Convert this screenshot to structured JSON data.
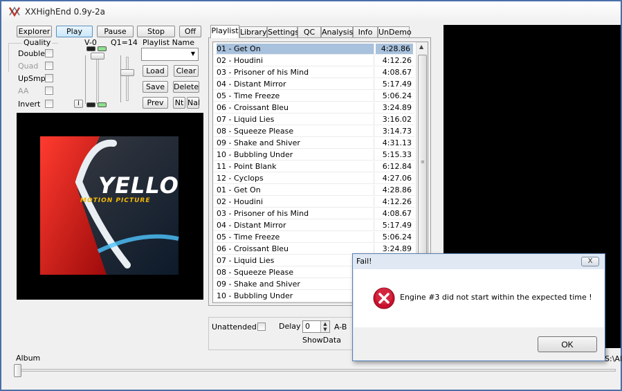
{
  "window": {
    "title": "XXHighEnd 0.9y-2a"
  },
  "transport": {
    "explorer": "Explorer",
    "play": "Play",
    "pause": "Pause",
    "stop": "Stop",
    "off": "Off"
  },
  "quality": {
    "title": "Quality",
    "options": [
      {
        "label": "Double",
        "enabled": true
      },
      {
        "label": "Quad",
        "enabled": false
      },
      {
        "label": "UpSmp",
        "enabled": true
      },
      {
        "label": "AA",
        "enabled": false
      },
      {
        "label": "Invert",
        "enabled": true
      }
    ]
  },
  "sliders": {
    "v_label": "V-0",
    "q_label": "Q1=14",
    "i_button": "I"
  },
  "playlist_controls": {
    "name_label": "Playlist Name",
    "load": "Load",
    "clear": "Clear",
    "save": "Save",
    "delete": "Delete",
    "prev": "Prev",
    "nt": "Nt",
    "nal": "Nal"
  },
  "album_art": {
    "artist": "YELLO",
    "album": "MOTION PICTURE"
  },
  "tabs": [
    "Playlist",
    "Library",
    "Settings",
    "QC",
    "Analysis",
    "Info",
    "UnDemo"
  ],
  "playlist": {
    "tracks": [
      {
        "name": "01 - Get On",
        "duration": "4:28.86",
        "selected": true
      },
      {
        "name": "02 - Houdini",
        "duration": "4:12.26"
      },
      {
        "name": "03 - Prisoner of his Mind",
        "duration": "4:08.67"
      },
      {
        "name": "04 - Distant Mirror",
        "duration": "5:17.49"
      },
      {
        "name": "05 - Time Freeze",
        "duration": "5:06.24"
      },
      {
        "name": "06 - Croissant Bleu",
        "duration": "3:24.89"
      },
      {
        "name": "07 - Liquid Lies",
        "duration": "3:16.02"
      },
      {
        "name": "08 - Squeeze Please",
        "duration": "3:14.73"
      },
      {
        "name": "09 - Shake and Shiver",
        "duration": "4:31.13"
      },
      {
        "name": "10 - Bubbling Under",
        "duration": "5:15.33"
      },
      {
        "name": "11 - Point Blank",
        "duration": "6:12.84"
      },
      {
        "name": "12 - Cyclops",
        "duration": "4:27.06"
      },
      {
        "name": "01 - Get On",
        "duration": "4:28.86"
      },
      {
        "name": "02 - Houdini",
        "duration": "4:12.26"
      },
      {
        "name": "03 - Prisoner of his Mind",
        "duration": "4:08.67"
      },
      {
        "name": "04 - Distant Mirror",
        "duration": "5:17.49"
      },
      {
        "name": "05 - Time Freeze",
        "duration": "5:06.24"
      },
      {
        "name": "06 - Croissant Bleu",
        "duration": "3:24.89"
      },
      {
        "name": "07 - Liquid Lies",
        "duration": ""
      },
      {
        "name": "08 - Squeeze Please",
        "duration": ""
      },
      {
        "name": "09 - Shake and Shiver",
        "duration": ""
      },
      {
        "name": "10 - Bubbling Under",
        "duration": ""
      }
    ]
  },
  "bottom": {
    "unattended": "Unattended",
    "delay_label": "Delay",
    "delay_value": "0",
    "ab_label": "A-B",
    "showdata": "ShowData",
    "album_label": "Album",
    "path_fragment": "S:\\All"
  },
  "dialog": {
    "title": "Fail!",
    "close": "X",
    "message": "Engine #3 did not start within the expected time !",
    "ok": "OK"
  },
  "colors": {
    "selection": "#a8c1dc",
    "error_red": "#c8102e",
    "window_border": "#4a6ea8"
  }
}
